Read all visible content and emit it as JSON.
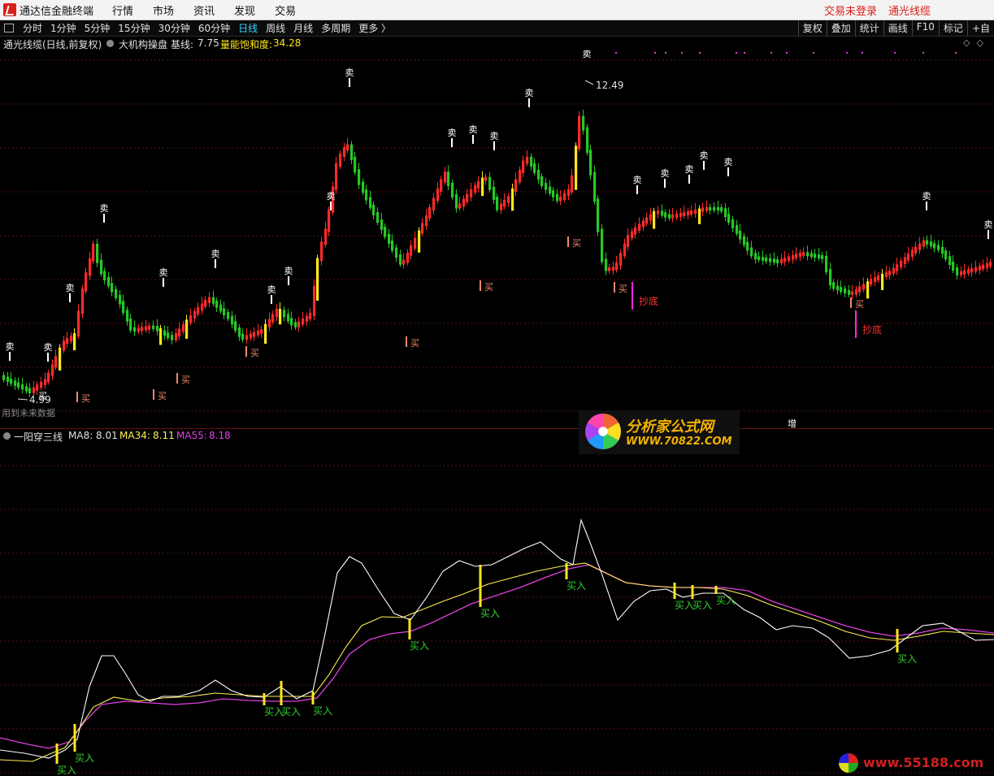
{
  "titlebar": {
    "app_title": "通达信金融终端",
    "menu": [
      "行情",
      "市场",
      "资讯",
      "发现",
      "交易"
    ],
    "right_links": [
      "交易未登录",
      "通光线缆"
    ]
  },
  "toolbar": {
    "periods": [
      "分时",
      "1分钟",
      "5分钟",
      "15分钟",
      "30分钟",
      "60分钟",
      "日线",
      "周线",
      "月线",
      "多周期",
      "更多 〉"
    ],
    "active_period": "日线",
    "tools": [
      "复权",
      "叠加",
      "统计",
      "画线",
      "F10",
      "标记",
      "+自"
    ]
  },
  "main_chart": {
    "stock_name": "通光线缆(日线,前复权)",
    "indicator_name": "大机构操盘",
    "baseline_label": "基线:",
    "baseline_value": "7.75",
    "saturation_label": "量能饱和度:",
    "saturation_value": "34.28",
    "max_price_label": "12.49",
    "min_price_label": "4.99",
    "future_data_note": "用到未来数据",
    "zeng_label": "增",
    "sell_label": "卖",
    "buy_label": "买",
    "bottom_label": "抄底",
    "colors": {
      "up": "#ff2a2a",
      "down": "#25c925",
      "yellow": "#ffe81a",
      "sell": "#ffffff",
      "buy": "#f08a6a",
      "bottom": "#ff2adf"
    }
  },
  "sub_chart": {
    "indicator_name": "一阳穿三线",
    "ma8_label": "MA8:",
    "ma8_value": "8.01",
    "ma34_label": "MA34:",
    "ma34_value": "8.11",
    "ma55_label": "MA55:",
    "ma55_value": "8.18",
    "buy_in_label": "买入",
    "colors": {
      "ma8": "#ffffff",
      "ma34": "#ffee55",
      "ma55": "#e040e0",
      "signal": "#ffe81a",
      "text": "#30d030"
    }
  },
  "watermarks": {
    "site_name": "分析家公式网",
    "site_url": "WWW.70822.COM",
    "site2_url": "www.55188.com"
  }
}
